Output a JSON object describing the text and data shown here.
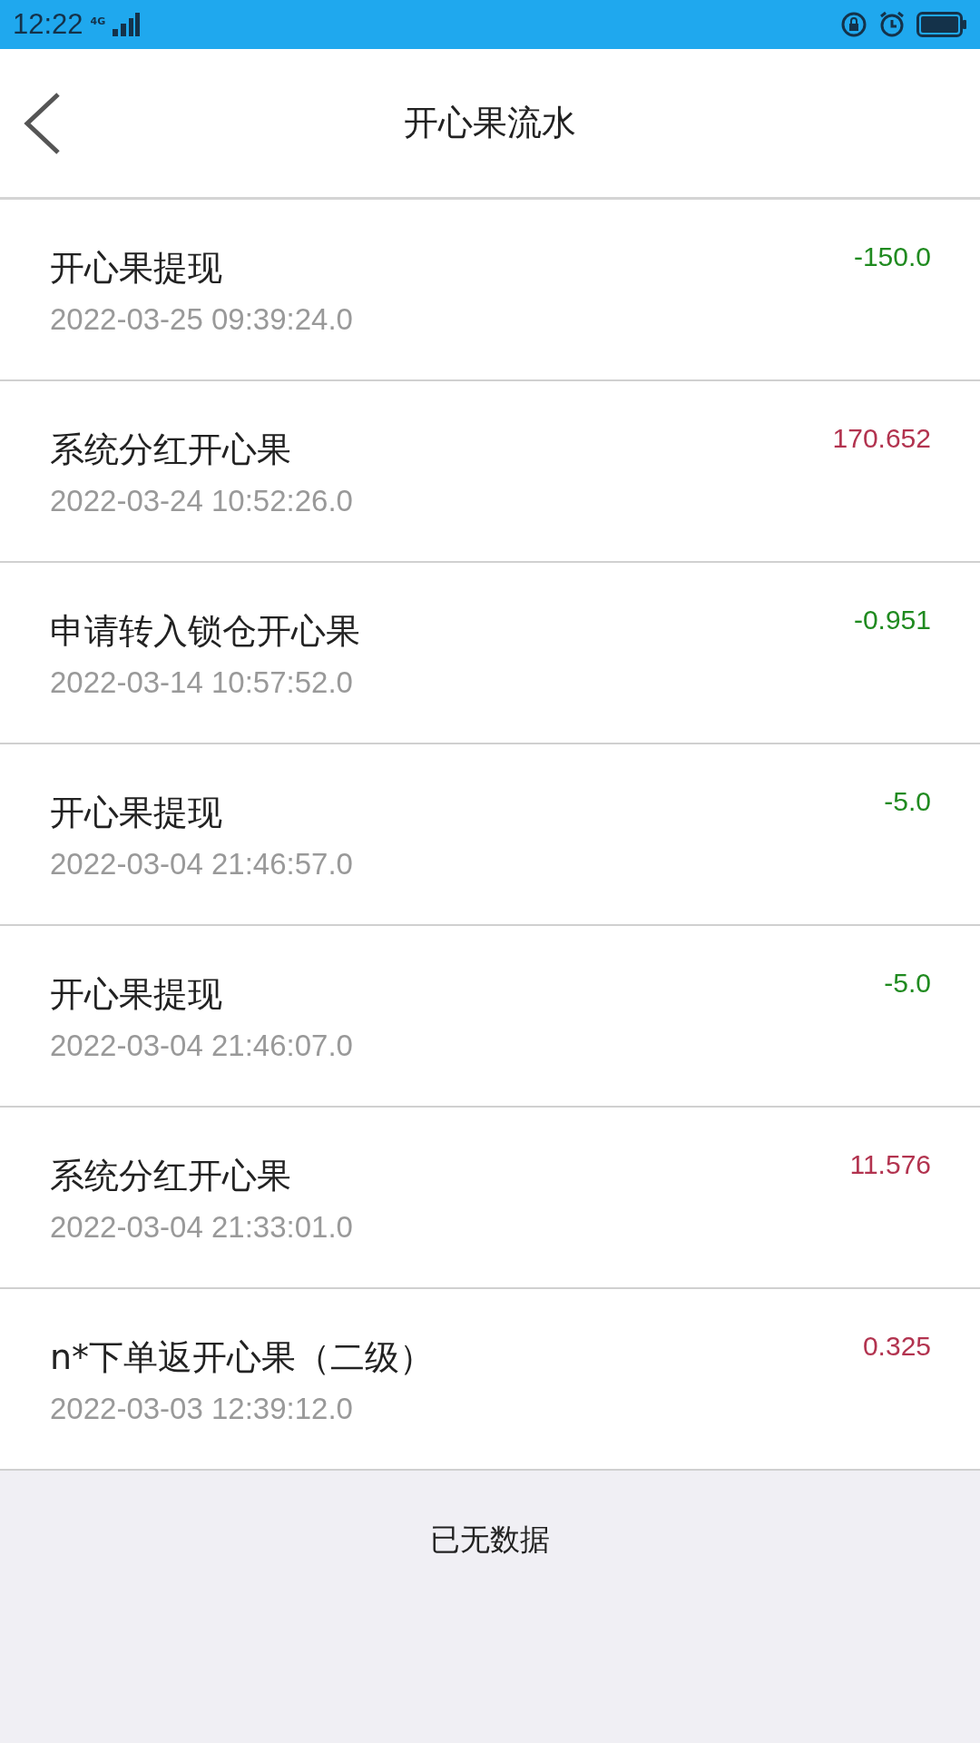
{
  "status_bar": {
    "time": "12:22",
    "network": "4G"
  },
  "header": {
    "title": "开心果流水"
  },
  "records": [
    {
      "title": "开心果提现",
      "date": "2022-03-25 09:39:24.0",
      "amount": "-150.0",
      "kind": "expense"
    },
    {
      "title": "系统分红开心果",
      "date": "2022-03-24 10:52:26.0",
      "amount": "170.652",
      "kind": "income"
    },
    {
      "title": "申请转入锁仓开心果",
      "date": "2022-03-14 10:57:52.0",
      "amount": "-0.951",
      "kind": "expense"
    },
    {
      "title": "开心果提现",
      "date": "2022-03-04 21:46:57.0",
      "amount": "-5.0",
      "kind": "expense"
    },
    {
      "title": "开心果提现",
      "date": "2022-03-04 21:46:07.0",
      "amount": "-5.0",
      "kind": "expense"
    },
    {
      "title": "系统分红开心果",
      "date": "2022-03-04 21:33:01.0",
      "amount": "11.576",
      "kind": "income"
    },
    {
      "title": "n*下单返开心果（二级）",
      "date": "2022-03-03 12:39:12.0",
      "amount": "0.325",
      "kind": "income"
    }
  ],
  "footer": {
    "text": "已无数据"
  }
}
